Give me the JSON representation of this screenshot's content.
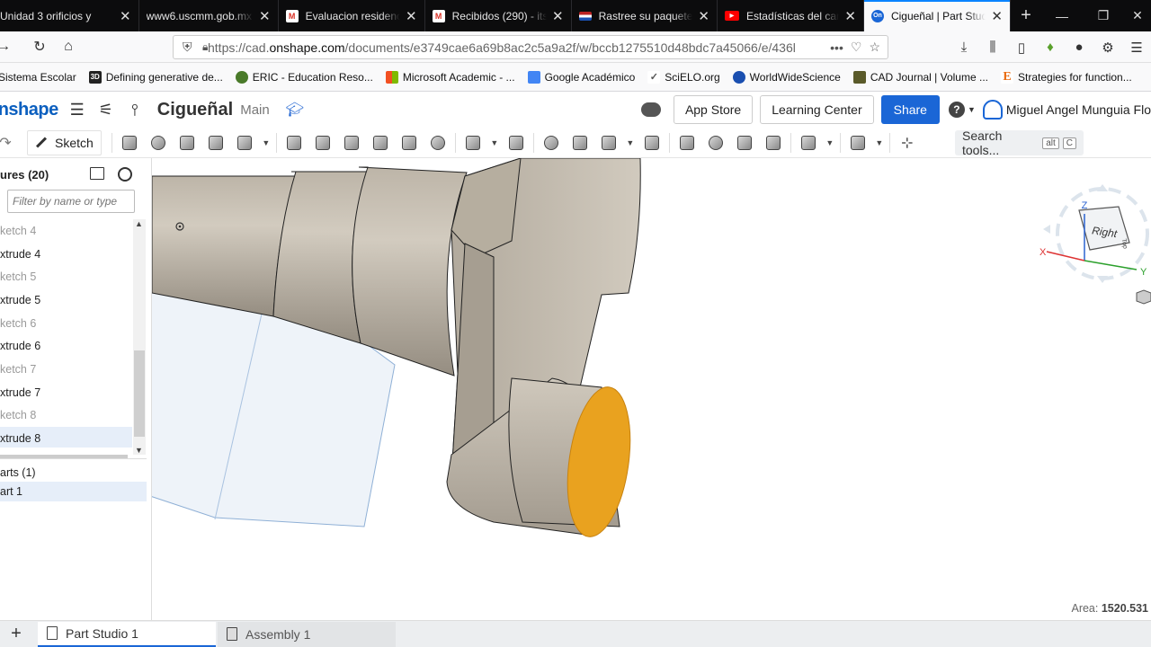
{
  "browser": {
    "tabs": [
      {
        "title": "Unidad 3 orificios y",
        "color": "#cc8800",
        "glyph": ""
      },
      {
        "title": "www6.uscmm.gob.mx",
        "color": "#0c0c0d",
        "glyph": ""
      },
      {
        "title": "Evaluacion residenc",
        "color": "#d93025",
        "glyph": "M"
      },
      {
        "title": "Recibidos (290) - its",
        "color": "#d93025",
        "glyph": "M"
      },
      {
        "title": "Rastree su paquete",
        "color": "#1a4fb0",
        "glyph": ""
      },
      {
        "title": "Estadísticas del can",
        "color": "#ff0000",
        "glyph": "▶"
      },
      {
        "title": "Cigueñal | Part Stud",
        "color": "#1a66d6",
        "glyph": "On"
      }
    ],
    "url_prefix": "https://cad.",
    "url_domain": "onshape.com",
    "url_rest": "/documents/e3749cae6a69b8ac2c5a9a2f/w/bccb1275510d48bdc7a45066/e/436l",
    "bookmarks": [
      {
        "label": "Sistema Escolar",
        "color": "#888888",
        "glyph": ""
      },
      {
        "label": "Defining generative de...",
        "color": "#222222",
        "glyph": "3D"
      },
      {
        "label": "ERIC - Education Reso...",
        "color": "#4a7a2a",
        "glyph": ""
      },
      {
        "label": "Microsoft Academic - ...",
        "color": "#f25022",
        "glyph": ""
      },
      {
        "label": "Google Académico",
        "color": "#4285f4",
        "glyph": ""
      },
      {
        "label": "SciELO.org",
        "color": "#555555",
        "glyph": ""
      },
      {
        "label": "WorldWideScience",
        "color": "#1a4fb0",
        "glyph": ""
      },
      {
        "label": "CAD Journal | Volume ...",
        "color": "#5a5a2a",
        "glyph": ""
      },
      {
        "label": "Strategies for function...",
        "color": "#e86a10",
        "glyph": "E"
      }
    ]
  },
  "app": {
    "logo": "onshape",
    "doc_title": "Cigueñal",
    "workspace": "Main",
    "app_store": "App Store",
    "learning_center": "Learning Center",
    "share": "Share",
    "help": "?",
    "user": "Miguel Angel Munguia Flo"
  },
  "toolbar": {
    "sketch": "Sketch",
    "search_tools": "Search tools...",
    "shortcut_1": "alt",
    "shortcut_2": "C"
  },
  "features": {
    "header": "ures (20)",
    "filter_placeholder": "Filter by name or type",
    "items": [
      {
        "label": "ketch 4",
        "dim": true
      },
      {
        "label": "xtrude 4",
        "dim": false
      },
      {
        "label": "ketch 5",
        "dim": true
      },
      {
        "label": "xtrude 5",
        "dim": false
      },
      {
        "label": "ketch 6",
        "dim": true
      },
      {
        "label": "xtrude 6",
        "dim": false
      },
      {
        "label": "ketch 7",
        "dim": true
      },
      {
        "label": "xtrude 7",
        "dim": false
      },
      {
        "label": "ketch 8",
        "dim": true
      },
      {
        "label": "xtrude 8",
        "dim": false
      }
    ],
    "parts_header": "arts (1)",
    "part": "art 1"
  },
  "viewport": {
    "area_label": "Area:",
    "area_value": "1520.531",
    "viewcube": {
      "face": "Right",
      "side": "Top",
      "x": "X",
      "y": "Y",
      "z": "Z"
    },
    "colors": {
      "body": "#c9c1b4",
      "selected_face": "#e9a21f",
      "plane": "#dfe8f2"
    }
  },
  "bottom_tabs": {
    "part_studio": "Part Studio 1",
    "assembly": "Assembly 1"
  }
}
